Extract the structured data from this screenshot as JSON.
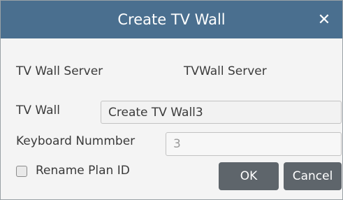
{
  "dialog": {
    "title": "Create TV Wall",
    "close_glyph": "✕"
  },
  "server": {
    "label": "TV Wall Server",
    "value": "TVWall Server"
  },
  "tv_wall": {
    "label": "TV Wall",
    "value": "Create TV Wall3"
  },
  "keyboard": {
    "label": "Keyboard Nummber",
    "value": "3"
  },
  "rename_plan": {
    "label": "Rename Plan ID",
    "checked": false
  },
  "buttons": {
    "ok": "OK",
    "cancel": "Cancel"
  },
  "colors": {
    "titlebar": "#4a6f8f",
    "button": "#5e656b",
    "background": "#f4f4f4"
  }
}
